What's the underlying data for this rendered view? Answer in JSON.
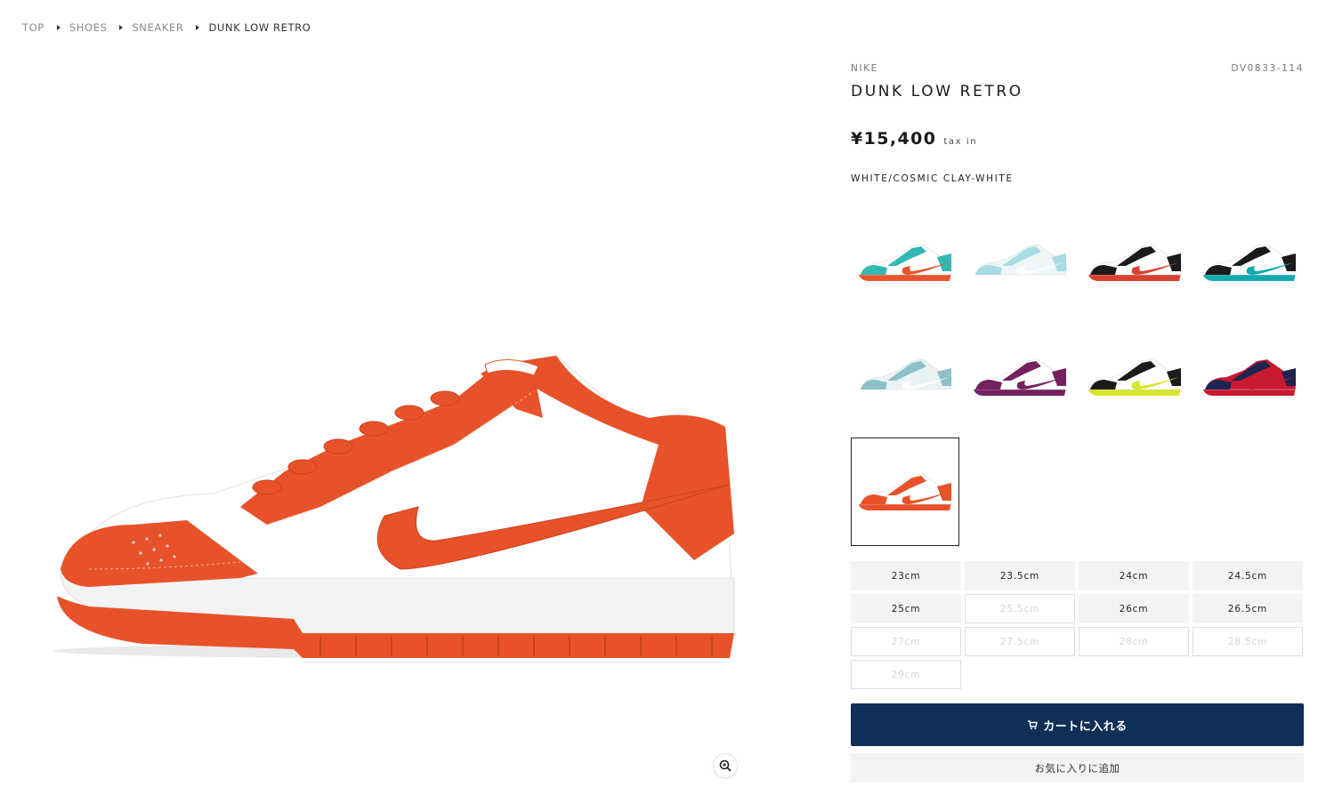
{
  "breadcrumb": {
    "items": [
      "TOP",
      "SHOES",
      "SNEAKER"
    ],
    "current": "DUNK LOW RETRO"
  },
  "product": {
    "brand": "NIKE",
    "sku": "DV0833-114",
    "title": "DUNK LOW RETRO",
    "price": "¥15,400",
    "tax_label": "tax in",
    "color": "WHITE/COSMIC CLAY-WHITE",
    "main_image": {
      "upper_color": "#e8522a",
      "base_color": "#ffffff",
      "sole_color": "#e8522a"
    }
  },
  "variants": [
    {
      "upper": "#33b9b2",
      "base": "#ffffff",
      "accent": "#e8552e",
      "selected": false
    },
    {
      "upper": "#a8dbe4",
      "base": "#eef6f8",
      "accent": "#ffffff",
      "selected": false
    },
    {
      "upper": "#1b1b1b",
      "base": "#ffffff",
      "accent": "#d8412f",
      "selected": false
    },
    {
      "upper": "#1b1b1b",
      "base": "#ffffff",
      "accent": "#14a8b0",
      "selected": false
    },
    {
      "upper": "#8dc1c8",
      "base": "#eaf3f4",
      "accent": "#ffffff",
      "selected": false
    },
    {
      "upper": "#74215e",
      "base": "#ffffff",
      "accent": "#74215e",
      "selected": false
    },
    {
      "upper": "#1b1b1b",
      "base": "#ffffff",
      "accent": "#d6e62a",
      "selected": false
    },
    {
      "upper": "#1d2450",
      "base": "#c8192e",
      "accent": "#c8192e",
      "selected": false
    },
    {
      "upper": "#e8522a",
      "base": "#ffffff",
      "accent": "#e8522a",
      "selected": true
    }
  ],
  "sizes": [
    {
      "label": "23cm",
      "available": true
    },
    {
      "label": "23.5cm",
      "available": true
    },
    {
      "label": "24cm",
      "available": true
    },
    {
      "label": "24.5cm",
      "available": true
    },
    {
      "label": "25cm",
      "available": true
    },
    {
      "label": "25.5cm",
      "available": false
    },
    {
      "label": "26cm",
      "available": true
    },
    {
      "label": "26.5cm",
      "available": true
    },
    {
      "label": "27cm",
      "available": false
    },
    {
      "label": "27.5cm",
      "available": false
    },
    {
      "label": "28cm",
      "available": false
    },
    {
      "label": "28.5cm",
      "available": false
    },
    {
      "label": "29cm",
      "available": false
    }
  ],
  "actions": {
    "cart_label": "カートに入れる",
    "favorite_label": "お気に入りに追加"
  },
  "colors": {
    "primary": "#0f2f57",
    "size_bg": "#f2f3f4"
  },
  "icons": {
    "cart": "cart-icon",
    "zoom": "zoom-in-icon",
    "breadcrumb_separator": "chevron-right-icon"
  }
}
